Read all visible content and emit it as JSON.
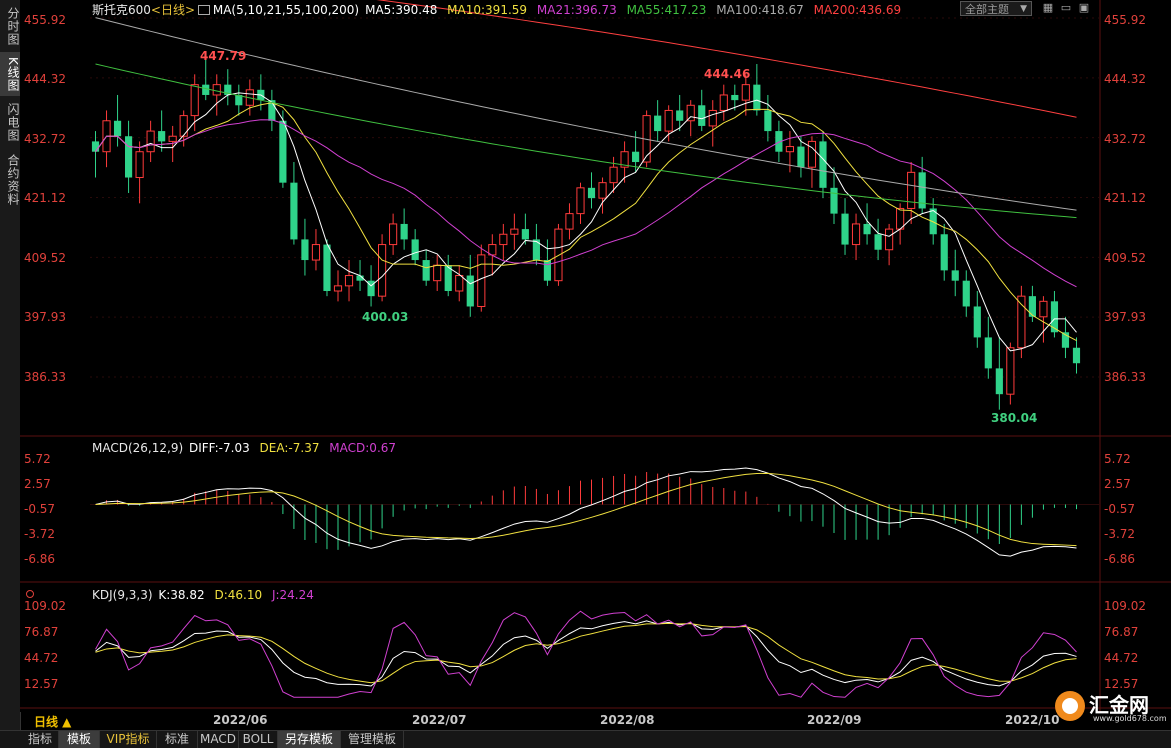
{
  "side_tabs": [
    "分时图",
    "K线图",
    "闪电图",
    "合约资料"
  ],
  "main_header": {
    "symbol": "斯托克600",
    "period_tag": "<日线>",
    "ma_params": "MA(5,10,21,55,100,200)",
    "ma_values": [
      {
        "label": "MA5:390.48",
        "color": "#ffffff"
      },
      {
        "label": "MA10:391.59",
        "color": "#f0e040"
      },
      {
        "label": "MA21:396.73",
        "color": "#d040d0"
      },
      {
        "label": "MA55:417.23",
        "color": "#40c040"
      },
      {
        "label": "MA100:418.67",
        "color": "#aaaaaa"
      },
      {
        "label": "MA200:436.69",
        "color": "#ff4040"
      }
    ]
  },
  "theme_select": {
    "value": "全部主题"
  },
  "price_axis_labels": [
    "455.92",
    "444.32",
    "432.72",
    "421.12",
    "409.52",
    "397.93",
    "386.33"
  ],
  "price_annotations": [
    {
      "text": "447.79",
      "color": "#ff5050"
    },
    {
      "text": "444.46",
      "color": "#ff5050"
    },
    {
      "text": "400.03",
      "color": "#40d080"
    },
    {
      "text": "380.04",
      "color": "#40d080"
    }
  ],
  "macd_header": {
    "title": "MACD(26,12,9)",
    "diff": "DIFF:-7.03",
    "dea": "DEA:-7.37",
    "macd": "MACD:0.67"
  },
  "macd_axis_labels": [
    "5.72",
    "2.57",
    "-0.57",
    "-3.72",
    "-6.86"
  ],
  "kdj_header": {
    "title": "KDJ(9,3,3)",
    "k": "K:38.82",
    "d": "D:46.10",
    "j": "J:24.24"
  },
  "kdj_axis_labels": [
    "109.02",
    "76.87",
    "44.72",
    "12.57"
  ],
  "period_label": "日线 ▲",
  "date_labels": [
    "2022/06",
    "2022/07",
    "2022/08",
    "2022/09",
    "2022/10"
  ],
  "bottom_tabs": [
    "指标",
    "模板",
    "VIP指标",
    "标准",
    "MACD",
    "BOLL",
    "另存模板",
    "管理模板"
  ],
  "logo": {
    "text": "汇金网",
    "url": "www.gold678.com"
  },
  "colors": {
    "up": "#ff3b3b",
    "down": "#2fd38a",
    "axis": "#e0413b",
    "grid": "#3a1010"
  },
  "chart_data": {
    "type": "candlestick",
    "title": "斯托克600",
    "yaxis_ticks": [
      455.92,
      444.32,
      432.72,
      421.12,
      409.52,
      397.93,
      386.33
    ],
    "ylim": [
      376,
      458
    ],
    "x_month_labels": [
      "2022/06",
      "2022/07",
      "2022/08",
      "2022/09",
      "2022/10"
    ],
    "candles": [
      [
        432,
        434,
        425,
        430
      ],
      [
        430,
        438,
        427,
        436
      ],
      [
        436,
        441,
        431,
        433
      ],
      [
        433,
        436,
        422,
        425
      ],
      [
        425,
        432,
        420,
        430
      ],
      [
        430,
        436,
        428,
        434
      ],
      [
        434,
        438,
        430,
        432
      ],
      [
        432,
        435,
        428,
        433
      ],
      [
        433,
        438,
        431,
        437
      ],
      [
        437,
        445,
        434,
        443
      ],
      [
        443,
        448,
        440,
        441
      ],
      [
        441,
        445,
        437,
        443
      ],
      [
        443,
        446,
        439,
        441
      ],
      [
        441,
        443,
        437,
        439
      ],
      [
        439,
        444,
        437,
        442
      ],
      [
        442,
        445,
        438,
        440
      ],
      [
        440,
        442,
        434,
        436
      ],
      [
        436,
        438,
        423,
        424
      ],
      [
        424,
        428,
        412,
        413
      ],
      [
        413,
        417,
        406,
        409
      ],
      [
        409,
        415,
        407,
        412
      ],
      [
        412,
        413,
        402,
        403
      ],
      [
        403,
        407,
        401,
        404
      ],
      [
        404,
        409,
        401,
        406
      ],
      [
        406,
        409,
        403,
        405
      ],
      [
        405,
        408,
        400,
        402
      ],
      [
        402,
        414,
        401,
        412
      ],
      [
        412,
        418,
        410,
        416
      ],
      [
        416,
        419,
        411,
        413
      ],
      [
        413,
        415,
        408,
        409
      ],
      [
        409,
        411,
        404,
        405
      ],
      [
        405,
        410,
        403,
        408
      ],
      [
        408,
        410,
        402,
        403
      ],
      [
        403,
        408,
        401,
        406
      ],
      [
        406,
        410,
        398,
        400
      ],
      [
        400,
        412,
        399,
        410
      ],
      [
        410,
        414,
        406,
        412
      ],
      [
        412,
        416,
        409,
        414
      ],
      [
        414,
        418,
        411,
        415
      ],
      [
        415,
        418,
        412,
        413
      ],
      [
        413,
        416,
        408,
        409
      ],
      [
        409,
        413,
        404,
        405
      ],
      [
        405,
        416,
        404,
        415
      ],
      [
        415,
        420,
        413,
        418
      ],
      [
        418,
        424,
        416,
        423
      ],
      [
        423,
        426,
        419,
        421
      ],
      [
        421,
        425,
        418,
        424
      ],
      [
        424,
        429,
        422,
        427
      ],
      [
        427,
        432,
        424,
        430
      ],
      [
        430,
        434,
        426,
        428
      ],
      [
        428,
        438,
        427,
        437
      ],
      [
        437,
        440,
        432,
        434
      ],
      [
        434,
        439,
        432,
        438
      ],
      [
        438,
        441,
        434,
        436
      ],
      [
        436,
        440,
        433,
        439
      ],
      [
        439,
        442,
        434,
        435
      ],
      [
        435,
        440,
        431,
        438
      ],
      [
        438,
        443,
        436,
        441
      ],
      [
        441,
        443,
        438,
        440
      ],
      [
        440,
        445,
        437,
        443
      ],
      [
        443,
        447,
        437,
        438
      ],
      [
        438,
        441,
        432,
        434
      ],
      [
        434,
        436,
        428,
        430
      ],
      [
        430,
        434,
        426,
        431
      ],
      [
        431,
        433,
        425,
        427
      ],
      [
        427,
        433,
        423,
        432
      ],
      [
        432,
        434,
        421,
        423
      ],
      [
        423,
        427,
        416,
        418
      ],
      [
        418,
        421,
        410,
        412
      ],
      [
        412,
        418,
        409,
        416
      ],
      [
        416,
        420,
        412,
        414
      ],
      [
        414,
        417,
        409,
        411
      ],
      [
        411,
        416,
        408,
        415
      ],
      [
        415,
        420,
        412,
        419
      ],
      [
        419,
        428,
        416,
        426
      ],
      [
        426,
        429,
        418,
        419
      ],
      [
        419,
        421,
        412,
        414
      ],
      [
        414,
        416,
        405,
        407
      ],
      [
        407,
        411,
        402,
        405
      ],
      [
        405,
        407,
        398,
        400
      ],
      [
        400,
        403,
        392,
        394
      ],
      [
        394,
        398,
        386,
        388
      ],
      [
        388,
        394,
        380,
        383
      ],
      [
        383,
        393,
        381,
        392
      ],
      [
        392,
        404,
        390,
        402
      ],
      [
        402,
        404,
        397,
        398
      ],
      [
        398,
        402,
        393,
        401
      ],
      [
        401,
        403,
        394,
        395
      ],
      [
        395,
        398,
        390,
        392
      ],
      [
        392,
        394,
        387,
        389
      ]
    ],
    "ma_series": [
      {
        "name": "MA5",
        "value": 390.48
      },
      {
        "name": "MA10",
        "value": 391.59
      },
      {
        "name": "MA21",
        "value": 396.73
      },
      {
        "name": "MA55",
        "value": 417.23
      },
      {
        "name": "MA100",
        "value": 418.67
      },
      {
        "name": "MA200",
        "value": 436.69
      }
    ],
    "macd": {
      "diff": -7.03,
      "dea": -7.37,
      "macd": 0.67,
      "yaxis_ticks": [
        5.72,
        2.57,
        -0.57,
        -3.72,
        -6.86
      ]
    },
    "kdj": {
      "k": 38.82,
      "d": 46.1,
      "j": 24.24,
      "yaxis_ticks": [
        109.02,
        76.87,
        44.72,
        12.57
      ]
    }
  }
}
